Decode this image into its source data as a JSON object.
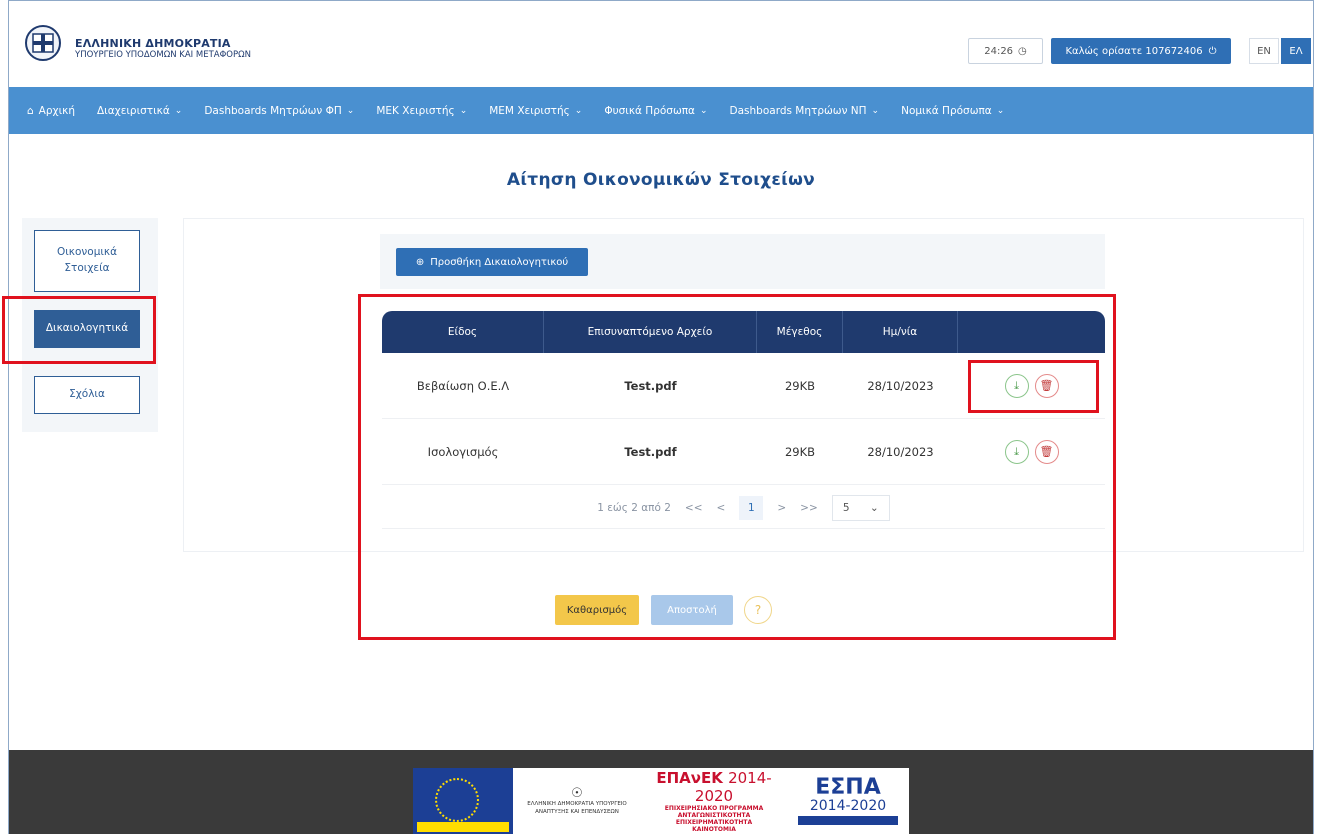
{
  "header": {
    "gov_title": "ΕΛΛΗΝΙΚΗ ΔΗΜΟΚΡΑΤΙΑ",
    "ministry": "ΥΠΟΥΡΓΕΙΟ ΥΠΟΔΟΜΩΝ ΚΑΙ ΜΕΤΑΦΟΡΩΝ",
    "session_timer": "24:26",
    "welcome": "Καλώς ορίσατε 107672406",
    "lang_en": "EN",
    "lang_el": "ΕΛ"
  },
  "nav": {
    "items": [
      {
        "label": "Αρχική",
        "icon": "home-icon",
        "dropdown": false
      },
      {
        "label": "Διαχειριστικά",
        "dropdown": true
      },
      {
        "label": "Dashboards Μητρώων ΦΠ",
        "dropdown": true
      },
      {
        "label": "ΜΕΚ Χειριστής",
        "dropdown": true
      },
      {
        "label": "ΜΕΜ Χειριστής",
        "dropdown": true
      },
      {
        "label": "Φυσικά Πρόσωπα",
        "dropdown": true
      },
      {
        "label": "Dashboards Μητρώων ΝΠ",
        "dropdown": true
      },
      {
        "label": "Νομικά Πρόσωπα",
        "dropdown": true
      }
    ]
  },
  "page": {
    "title": "Αίτηση Οικονομικών Στοιχείων"
  },
  "sidebar": {
    "items": [
      {
        "label": "Οικονομικά Στοιχεία",
        "active": false
      },
      {
        "label": "Δικαιολογητικά",
        "active": true
      },
      {
        "label": "Σχόλια",
        "active": false
      }
    ]
  },
  "documents": {
    "add_label": "Προσθήκη Δικαιολογητικού",
    "columns": [
      "Είδος",
      "Επισυναπτόμενο Αρχείο",
      "Μέγεθος",
      "Ημ/νία",
      ""
    ],
    "rows": [
      {
        "type": "Βεβαίωση Ο.Ε.Λ",
        "file": "Test.pdf",
        "size": "29KB",
        "date": "28/10/2023"
      },
      {
        "type": "Ισολογισμός",
        "file": "Test.pdf",
        "size": "29KB",
        "date": "28/10/2023"
      }
    ],
    "pagination": {
      "summary": "1 εώς 2 από 2",
      "first": "<<",
      "prev": "<",
      "current": "1",
      "next": ">",
      "last": ">>",
      "page_size": "5"
    }
  },
  "actions": {
    "clear": "Καθαρισμός",
    "send": "Αποστολή",
    "help": "?"
  },
  "footer": {
    "ministry_lines": "ΕΛΛΗΝΙΚΗ ΔΗΜΟΚΡΑΤΙΑ ΥΠΟΥΡΓΕΙΟ ΑΝΑΠΤΥΞΗΣ ΚΑΙ ΕΠΕΝΔΥΣΕΩΝ",
    "epanek": "ΕΠΑνΕΚ",
    "epanek_years": "2014-2020",
    "epanek_sub1": "ΕΠΙΧΕΙΡΗΣΙΑΚΟ ΠΡΟΓΡΑΜΜΑ",
    "epanek_sub2": "ΑΝΤΑΓΩΝΙΣΤΙΚΟΤΗΤΑ",
    "epanek_sub3": "ΕΠΙΧΕΙΡΗΜΑΤΙΚΟΤΗΤΑ",
    "epanek_sub4": "ΚΑΙΝΟΤΟΜΙΑ",
    "espa": "ΕΣΠΑ",
    "espa_years": "2014-2020"
  },
  "colors": {
    "nav_bg": "#4a90d0",
    "primary": "#2f6fb5",
    "table_header": "#1f3a6e",
    "highlight": "#e0121e",
    "warning": "#f3c74a"
  }
}
